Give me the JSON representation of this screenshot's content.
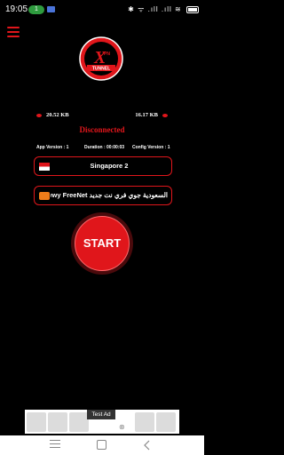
{
  "status_bar": {
    "time": "19:05",
    "notification_count": "1",
    "right_icons": "✱ ᯤ .ıll .ıll ≋"
  },
  "logo": {
    "letter": "X",
    "small": "PN",
    "text": "TUNNEL"
  },
  "stats": {
    "download": "20.52 KB",
    "upload": "16.17 KB"
  },
  "connection": {
    "status": "Disconnected"
  },
  "versions": {
    "app": "App Version : 1",
    "duration": "Duration : 00:00:03",
    "config": "Config Version : 1"
  },
  "server": {
    "name": "Singapore 2"
  },
  "payload": {
    "name": "السعودية جوي فري نت جديد Jawwy FreeNet"
  },
  "start_button": {
    "label": "START"
  },
  "ad": {
    "label": "Test Ad",
    "close": "⊗"
  },
  "colors": {
    "accent": "#e0161b",
    "background": "#000000"
  }
}
